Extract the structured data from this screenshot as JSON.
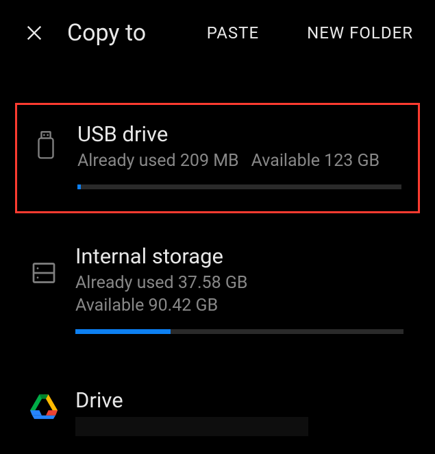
{
  "header": {
    "title": "Copy to",
    "paste_label": "PASTE",
    "new_folder_label": "NEW FOLDER"
  },
  "storage": {
    "usb": {
      "title": "USB drive",
      "used_label": "Already used 209 MB",
      "avail_label": "Available 123 GB",
      "fill_pct": 1
    },
    "internal": {
      "title": "Internal storage",
      "used_label": "Already used 37.58 GB",
      "avail_label": "Available 90.42 GB",
      "fill_pct": 29
    },
    "drive": {
      "title": "Drive"
    }
  }
}
